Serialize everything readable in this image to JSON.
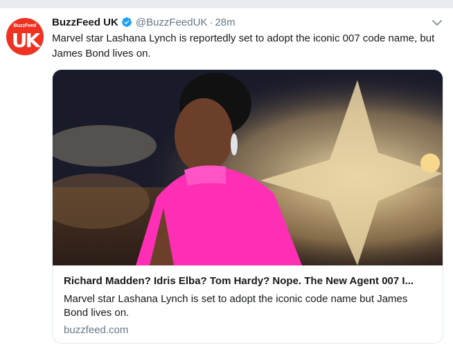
{
  "tweet": {
    "author_name": "BuzzFeed UK",
    "handle": "@BuzzFeedUK",
    "separator": "·",
    "time": "28m",
    "text": "Marvel star Lashana Lynch is reportedly set to adopt the iconic 007 code name, but James Bond lives on.",
    "avatar": {
      "brand": "BuzzFeed",
      "letters": "UK"
    }
  },
  "card": {
    "title": "Richard Madden? Idris Elba? Tom Hardy? Nope. The New Agent 007 I...",
    "description": "Marvel star Lashana Lynch is set to adopt the iconic code name but James Bond lives on.",
    "domain": "buzzfeed.com"
  },
  "colors": {
    "brand": "#ee3322",
    "verified": "#1da1f2",
    "secondary_text": "#657786",
    "dress": "#ff2fb5"
  },
  "icons": [
    "verified-badge-icon",
    "chevron-down-icon"
  ]
}
